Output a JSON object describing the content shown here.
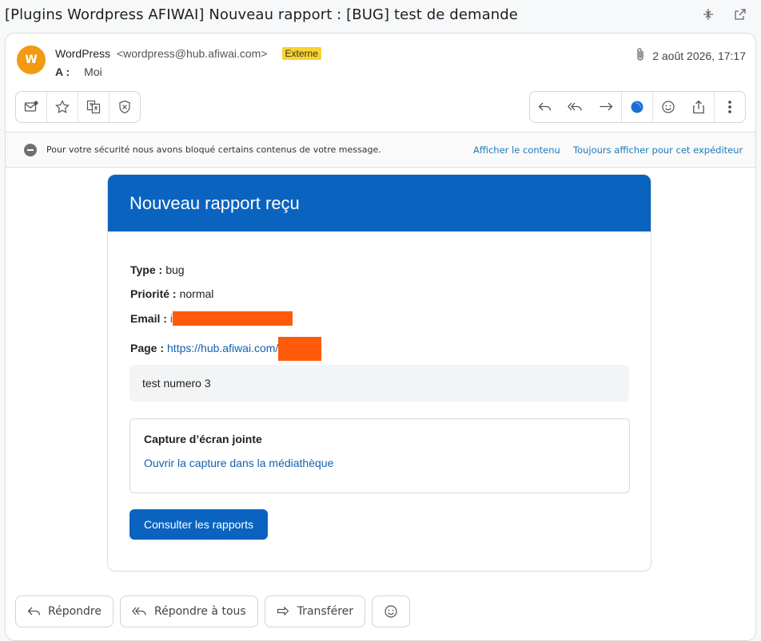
{
  "subject": "[Plugins Wordpress AFIWAI] Nouveau rapport : [BUG] test de demande",
  "header": {
    "avatar_initial": "W",
    "sender_name": "WordPress",
    "sender_email": "<wordpress@hub.afiwai.com>",
    "badge": "Externe",
    "to_label": "A :",
    "to_value": "Moi",
    "date": "2 août 2026, 17:17"
  },
  "security": {
    "message": "Pour votre sécurité nous avons bloqué certains contenus de votre message.",
    "show_content": "Afficher le contenu",
    "always_show": "Toujours afficher pour cet expéditeur"
  },
  "email_body": {
    "title": "Nouveau rapport reçu",
    "type_label": "Type :",
    "type_value": "bug",
    "priority_label": "Priorité :",
    "priority_value": "normal",
    "email_label": "Email :",
    "email_value_visible": "i",
    "page_label": "Page :",
    "page_value_visible": "https://hub.afiwai.com/",
    "message": "test numero 3",
    "capture_title": "Capture d’écran jointe",
    "capture_link": "Ouvrir la capture dans la médiathèque",
    "cta": "Consulter les rapports"
  },
  "reply_actions": {
    "reply": "Répondre",
    "reply_all": "Répondre à tous",
    "forward": "Transférer"
  },
  "colors": {
    "header_blue": "#0a63bf",
    "badge_yellow": "#f9d32f",
    "avatar_orange": "#f29a12",
    "redaction": "#ff5a0a"
  }
}
